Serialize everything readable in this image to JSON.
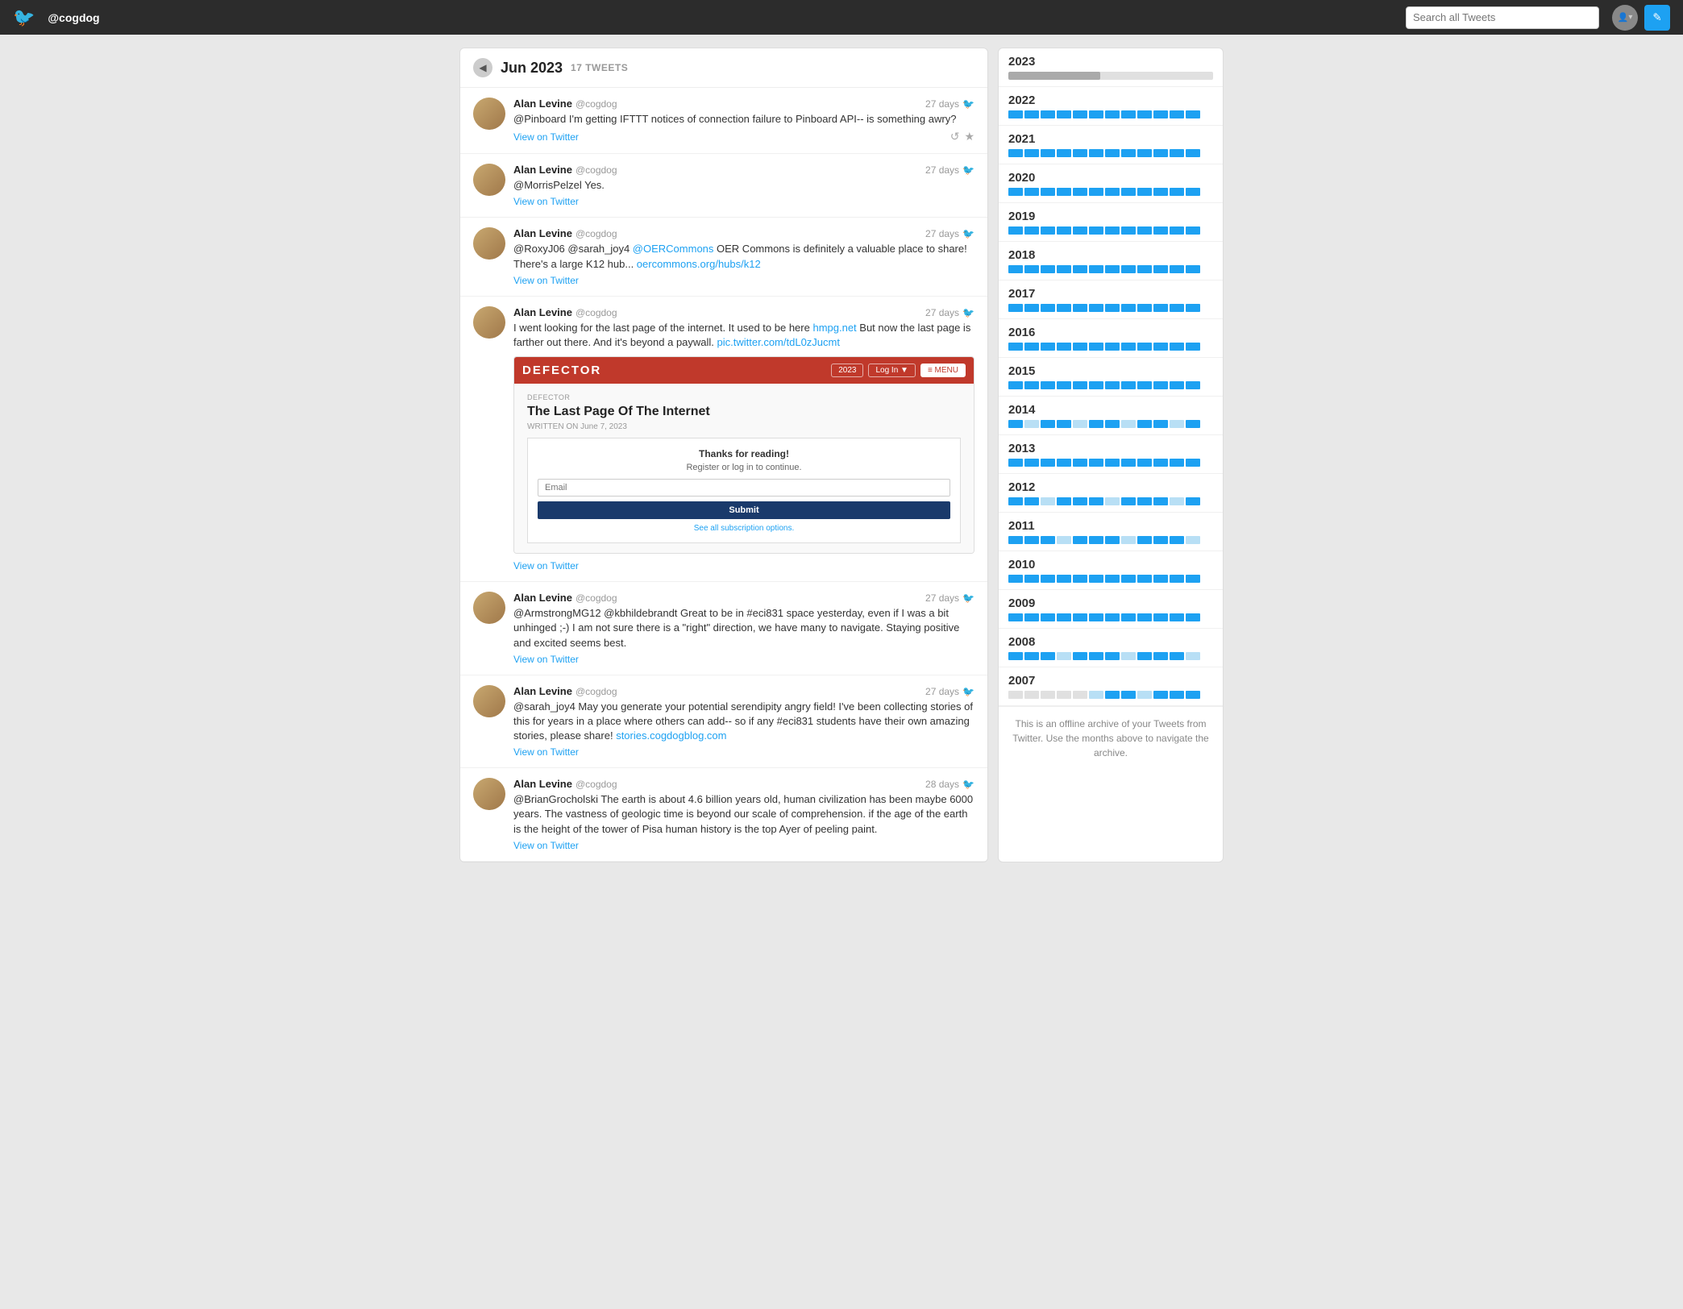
{
  "header": {
    "username": "@cogdog",
    "search_placeholder": "Search all Tweets",
    "logo_char": "🐦",
    "compose_char": "✎"
  },
  "panel": {
    "back_label": "◀",
    "title": "Jun 2023",
    "tweet_count": "17 TWEETS"
  },
  "tweets": [
    {
      "id": 1,
      "author": "Alan Levine",
      "handle": "@cogdog",
      "time": "27 days",
      "text": "@Pinboard I'm getting IFTTT notices of connection failure to Pinboard API-- is something awry?",
      "view_link": "View on Twitter",
      "has_actions": true
    },
    {
      "id": 2,
      "author": "Alan Levine",
      "handle": "@cogdog",
      "time": "27 days",
      "text": "@MorrisPelzel Yes.",
      "view_link": "View on Twitter",
      "has_actions": false
    },
    {
      "id": 3,
      "author": "Alan Levine",
      "handle": "@cogdog",
      "time": "27 days",
      "text": "@RoxyJ06 @sarah_joy4 @OERCommons OER Commons is definitely a valuable place to share! There's a large K12 hub... oercommons.org/hubs/k12",
      "view_link": "View on Twitter",
      "has_actions": false
    },
    {
      "id": 4,
      "author": "Alan Levine",
      "handle": "@cogdog",
      "time": "27 days",
      "text": "I went looking for the last page of the internet. It used to be here hmpg.net But now the last page is farther out there. And it's beyond a paywall. pic.twitter.com/tdL0zJucmt",
      "view_link": "View on Twitter",
      "has_preview": true,
      "preview": {
        "logo": "DEFECTOR",
        "label": "DEFECTOR",
        "headline": "The Last Page Of The Internet",
        "byline": "WRITTEN ON June 7, 2023",
        "signup_title": "Thanks for reading!",
        "signup_sub": "Register or log in to continue.",
        "email_placeholder": "Email",
        "submit_label": "Submit",
        "all_options": "See all subscription options."
      }
    },
    {
      "id": 5,
      "author": "Alan Levine",
      "handle": "@cogdog",
      "time": "27 days",
      "text": "@ArmstrongMG12 @kbhildebrandt Great to be in #eci831 space yesterday, even if I was a bit unhinged ;-) I am not sure there is a \"right\" direction, we have many to navigate. Staying positive and excited seems best.",
      "view_link": "View on Twitter",
      "has_actions": false
    },
    {
      "id": 6,
      "author": "Alan Levine",
      "handle": "@cogdog",
      "time": "27 days",
      "text": "@sarah_joy4 May you generate your potential serendipity angry field! I've been collecting stories of this for years in a place where others can add-- so if any #eci831 students have their own amazing stories, please share! stories.cogdogblog.com",
      "view_link": "View on Twitter",
      "has_actions": false
    },
    {
      "id": 7,
      "author": "Alan Levine",
      "handle": "@cogdog",
      "time": "28 days",
      "text": "@BrianGrocholski The earth is about 4.6 billion years old, human civilization has been maybe 6000 years. The vastness of geologic time is beyond our scale of comprehension. if the age of the earth is the height of the tower of Pisa human history is the top Ayer of peeling paint.",
      "view_link": "View on Twitter",
      "has_actions": false
    }
  ],
  "archive": {
    "years": [
      {
        "year": "2023",
        "progress": 45,
        "months": [
          {
            "active": true
          },
          {
            "active": true
          },
          {
            "active": true
          },
          {
            "active": true
          },
          {
            "active": true
          },
          {
            "current": true
          },
          {
            "empty": true
          },
          {
            "empty": true
          },
          {
            "empty": true
          },
          {
            "empty": true
          },
          {
            "empty": true
          },
          {
            "empty": true
          }
        ]
      },
      {
        "year": "2022",
        "months": [
          {
            "active": true
          },
          {
            "active": true
          },
          {
            "active": true
          },
          {
            "active": true
          },
          {
            "active": true
          },
          {
            "active": true
          },
          {
            "active": true
          },
          {
            "active": true
          },
          {
            "active": true
          },
          {
            "active": true
          },
          {
            "active": true
          },
          {
            "active": true
          }
        ]
      },
      {
        "year": "2021",
        "months": [
          {
            "active": true
          },
          {
            "active": true
          },
          {
            "active": true
          },
          {
            "active": true
          },
          {
            "active": true
          },
          {
            "active": true
          },
          {
            "active": true
          },
          {
            "active": true
          },
          {
            "active": true
          },
          {
            "active": true
          },
          {
            "active": true
          },
          {
            "active": true
          }
        ]
      },
      {
        "year": "2020",
        "months": [
          {
            "active": true
          },
          {
            "active": true
          },
          {
            "active": true
          },
          {
            "active": true
          },
          {
            "active": true
          },
          {
            "active": true
          },
          {
            "active": true
          },
          {
            "active": true
          },
          {
            "active": true
          },
          {
            "active": true
          },
          {
            "active": true
          },
          {
            "active": true
          }
        ]
      },
      {
        "year": "2019",
        "months": [
          {
            "active": true
          },
          {
            "active": true
          },
          {
            "active": true
          },
          {
            "active": true
          },
          {
            "active": true
          },
          {
            "active": true
          },
          {
            "active": true
          },
          {
            "active": true
          },
          {
            "active": true
          },
          {
            "active": true
          },
          {
            "active": true
          },
          {
            "active": true
          }
        ]
      },
      {
        "year": "2018",
        "months": [
          {
            "active": true
          },
          {
            "active": true
          },
          {
            "active": true
          },
          {
            "active": true
          },
          {
            "active": true
          },
          {
            "active": true
          },
          {
            "active": true
          },
          {
            "active": true
          },
          {
            "active": true
          },
          {
            "active": true
          },
          {
            "active": true
          },
          {
            "active": true
          }
        ]
      },
      {
        "year": "2017",
        "months": [
          {
            "active": true
          },
          {
            "active": true
          },
          {
            "active": true
          },
          {
            "active": true
          },
          {
            "active": true
          },
          {
            "active": true
          },
          {
            "active": true
          },
          {
            "active": true
          },
          {
            "active": true
          },
          {
            "active": true
          },
          {
            "active": true
          },
          {
            "active": true
          }
        ]
      },
      {
        "year": "2016",
        "months": [
          {
            "active": true
          },
          {
            "active": true
          },
          {
            "active": true
          },
          {
            "active": true
          },
          {
            "active": true
          },
          {
            "active": true
          },
          {
            "active": true
          },
          {
            "active": true
          },
          {
            "active": true
          },
          {
            "active": true
          },
          {
            "active": true
          },
          {
            "active": true
          }
        ]
      },
      {
        "year": "2015",
        "months": [
          {
            "active": true
          },
          {
            "active": true
          },
          {
            "active": true
          },
          {
            "active": true
          },
          {
            "active": true
          },
          {
            "active": true
          },
          {
            "active": true
          },
          {
            "active": true
          },
          {
            "active": true
          },
          {
            "active": true
          },
          {
            "active": true
          },
          {
            "active": true
          }
        ]
      },
      {
        "year": "2014",
        "months": [
          {
            "active": true
          },
          {
            "dim": true
          },
          {
            "active": true
          },
          {
            "active": true
          },
          {
            "dim": true
          },
          {
            "active": true
          },
          {
            "active": true
          },
          {
            "dim": true
          },
          {
            "active": true
          },
          {
            "active": true
          },
          {
            "dim": true
          },
          {
            "active": true
          }
        ]
      },
      {
        "year": "2013",
        "months": [
          {
            "active": true
          },
          {
            "active": true
          },
          {
            "active": true
          },
          {
            "active": true
          },
          {
            "active": true
          },
          {
            "active": true
          },
          {
            "active": true
          },
          {
            "active": true
          },
          {
            "active": true
          },
          {
            "active": true
          },
          {
            "active": true
          },
          {
            "active": true
          }
        ]
      },
      {
        "year": "2012",
        "months": [
          {
            "active": true
          },
          {
            "active": true
          },
          {
            "dim": true
          },
          {
            "active": true
          },
          {
            "active": true
          },
          {
            "active": true
          },
          {
            "dim": true
          },
          {
            "active": true
          },
          {
            "active": true
          },
          {
            "active": true
          },
          {
            "dim": true
          },
          {
            "active": true
          }
        ]
      },
      {
        "year": "2011",
        "months": [
          {
            "active": true
          },
          {
            "active": true
          },
          {
            "active": true
          },
          {
            "dim": true
          },
          {
            "active": true
          },
          {
            "active": true
          },
          {
            "active": true
          },
          {
            "dim": true
          },
          {
            "active": true
          },
          {
            "active": true
          },
          {
            "active": true
          },
          {
            "dim": true
          }
        ]
      },
      {
        "year": "2010",
        "months": [
          {
            "active": true
          },
          {
            "active": true
          },
          {
            "active": true
          },
          {
            "active": true
          },
          {
            "active": true
          },
          {
            "active": true
          },
          {
            "active": true
          },
          {
            "active": true
          },
          {
            "active": true
          },
          {
            "active": true
          },
          {
            "active": true
          },
          {
            "active": true
          }
        ]
      },
      {
        "year": "2009",
        "months": [
          {
            "active": true
          },
          {
            "active": true
          },
          {
            "active": true
          },
          {
            "active": true
          },
          {
            "active": true
          },
          {
            "active": true
          },
          {
            "active": true
          },
          {
            "active": true
          },
          {
            "active": true
          },
          {
            "active": true
          },
          {
            "active": true
          },
          {
            "active": true
          }
        ]
      },
      {
        "year": "2008",
        "months": [
          {
            "active": true
          },
          {
            "active": true
          },
          {
            "active": true
          },
          {
            "dim": true
          },
          {
            "active": true
          },
          {
            "active": true
          },
          {
            "active": true
          },
          {
            "dim": true
          },
          {
            "active": true
          },
          {
            "active": true
          },
          {
            "active": true
          },
          {
            "dim": true
          }
        ]
      },
      {
        "year": "2007",
        "months": [
          {
            "empty": true
          },
          {
            "empty": true
          },
          {
            "empty": true
          },
          {
            "empty": true
          },
          {
            "empty": true
          },
          {
            "dim": true
          },
          {
            "active": true
          },
          {
            "active": true
          },
          {
            "dim": true
          },
          {
            "active": true
          },
          {
            "active": true
          },
          {
            "active": true
          }
        ]
      }
    ],
    "footer": "This is an offline archive of your Tweets from Twitter. Use the months above to navigate the archive."
  }
}
